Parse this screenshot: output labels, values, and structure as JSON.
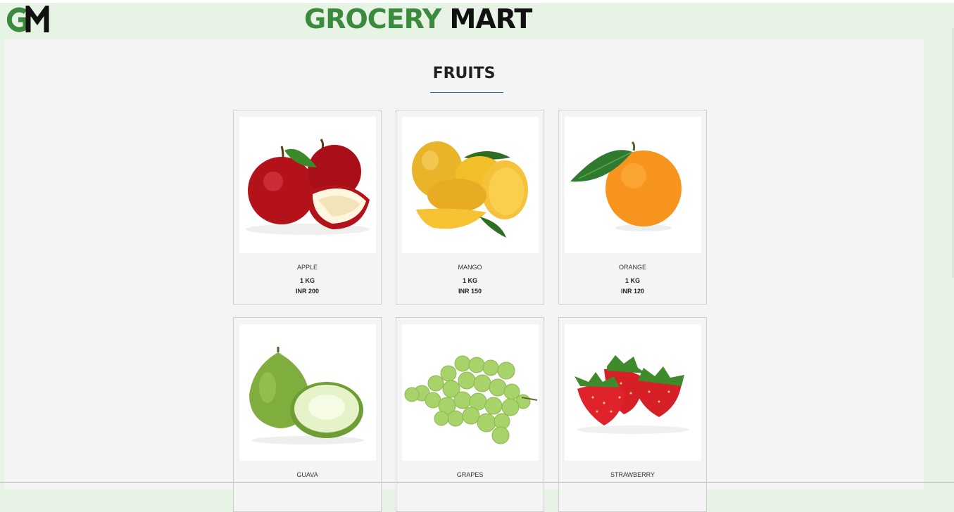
{
  "header": {
    "logo_text": "GM",
    "title_part1": "GROCERY",
    "title_part2": "MART"
  },
  "section": {
    "title": "FRUITS"
  },
  "products": [
    {
      "name": "APPLE",
      "qty": "1 KG",
      "price": "INR 200"
    },
    {
      "name": "MANGO",
      "qty": "1 KG",
      "price": "INR 150"
    },
    {
      "name": "ORANGE",
      "qty": "1 KG",
      "price": "INR 120"
    },
    {
      "name": "GUAVA",
      "qty": "",
      "price": ""
    },
    {
      "name": "GRAPES",
      "qty": "",
      "price": ""
    },
    {
      "name": "STRAWBERRY",
      "qty": "",
      "price": ""
    }
  ],
  "colors": {
    "brand_green": "#3b8a3e",
    "page_bg": "#e7f3e5",
    "panel_bg": "#f4f4f4"
  }
}
